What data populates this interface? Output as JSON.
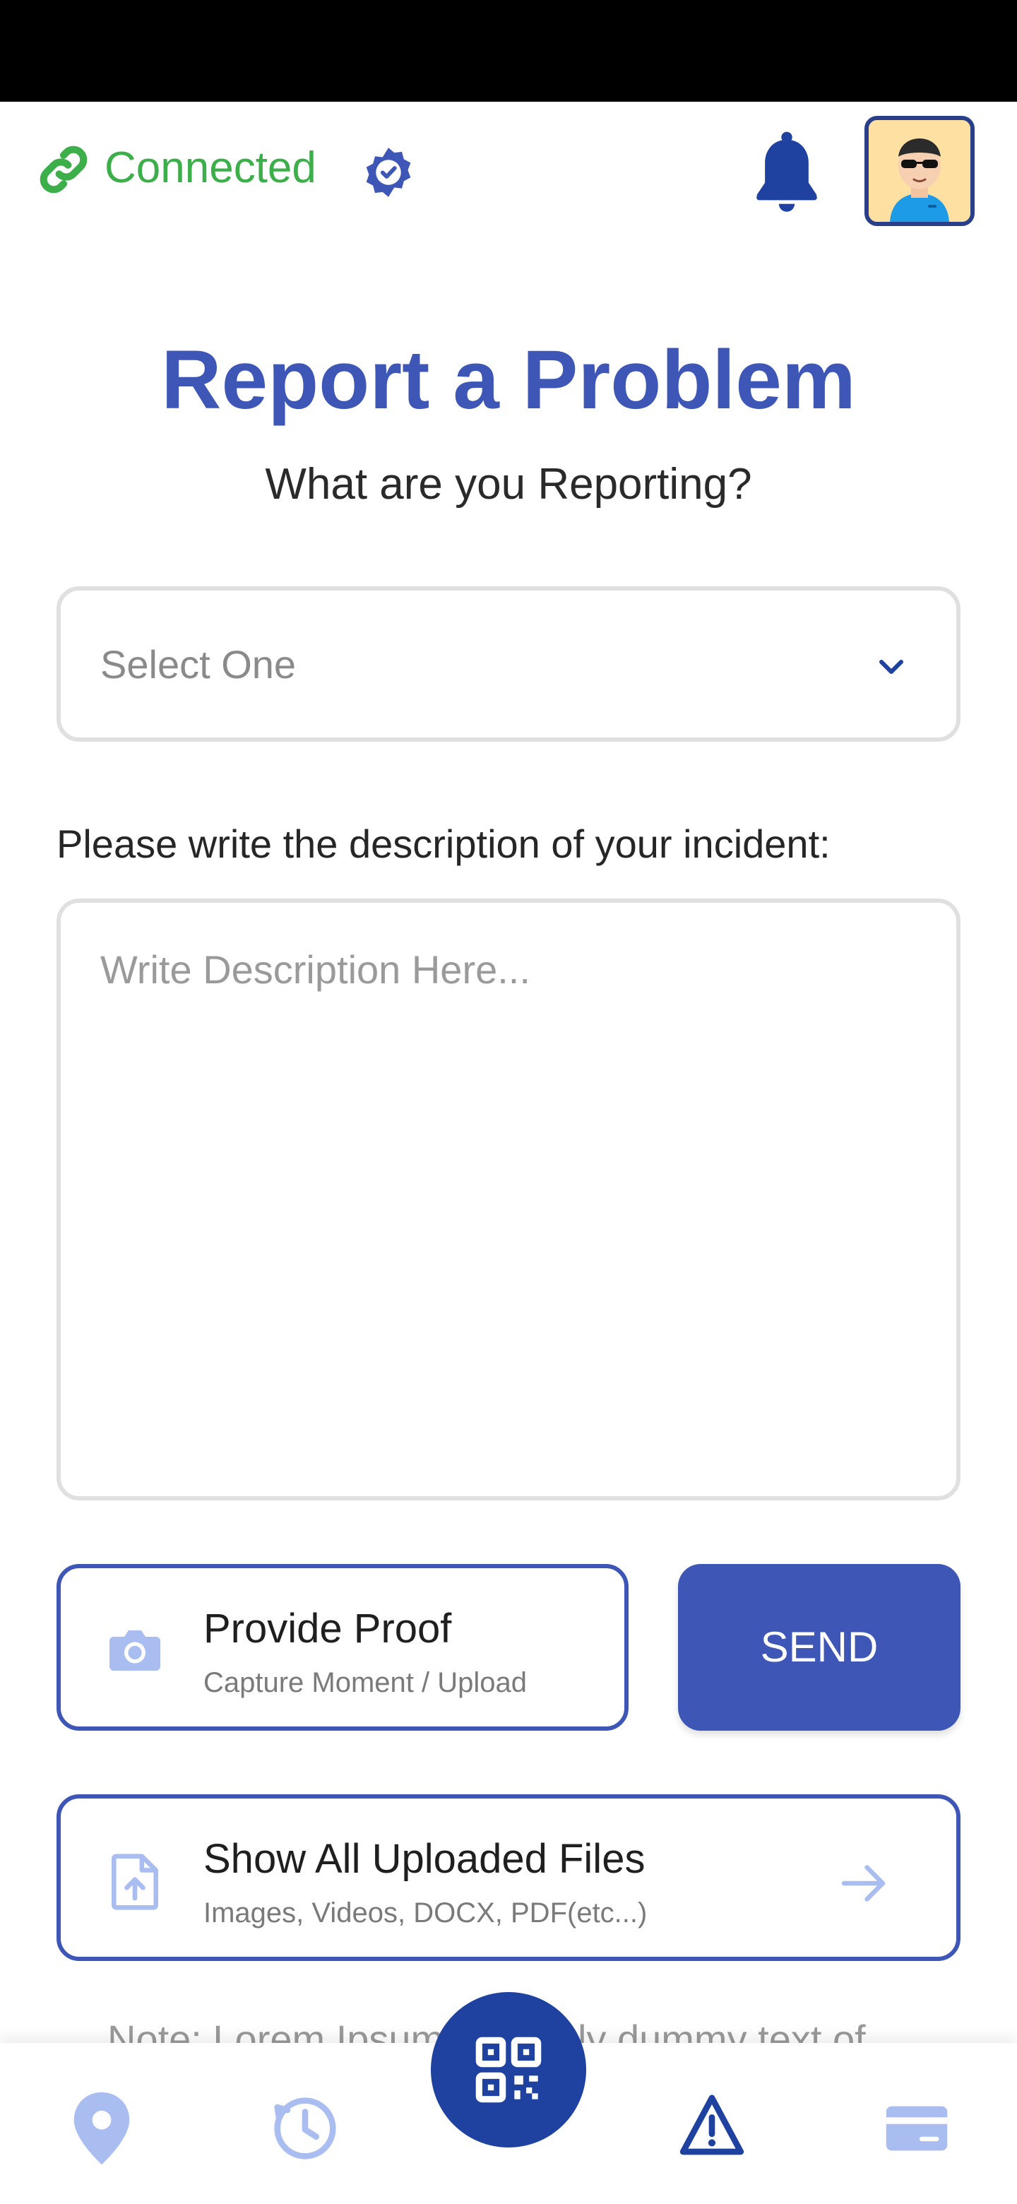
{
  "header": {
    "connection_label": "Connected",
    "icons": [
      "link-icon",
      "verified-badge-icon",
      "bell-icon"
    ],
    "avatar": "user-avatar"
  },
  "page": {
    "title": "Report a Problem",
    "subtitle": "What are you Reporting?"
  },
  "form": {
    "select_placeholder": "Select One",
    "description_label": "Please write the description of your incident:",
    "description_placeholder": "Write Description Here..."
  },
  "actions": {
    "proof_title": "Provide Proof",
    "proof_subtitle": "Capture Moment  / Upload",
    "send_label": "SEND",
    "files_title": "Show All Uploaded Files",
    "files_subtitle": "Images, Videos, DOCX, PDF(etc...)"
  },
  "note": "Note: Lorem Ipsum is simply dummy text of",
  "nav": {
    "items": [
      "location-icon",
      "history-icon",
      "qr-code-icon",
      "warning-icon",
      "card-icon"
    ]
  },
  "colors": {
    "primary": "#3e57b6",
    "connected": "#3cae4a",
    "fab": "#1f42a0",
    "light_icon": "#a9bdf0"
  }
}
